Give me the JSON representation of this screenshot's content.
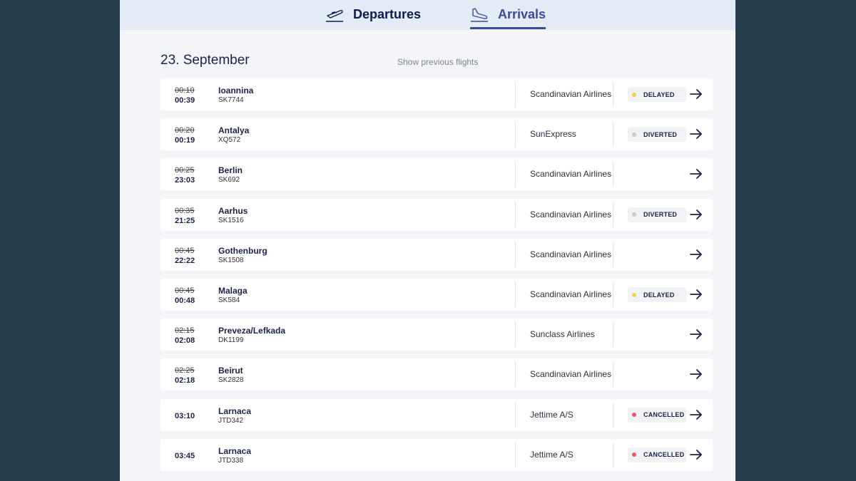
{
  "tabs": {
    "departures": "Departures",
    "arrivals": "Arrivals"
  },
  "date_title": "23. September",
  "show_previous": "Show previous flights",
  "colors": {
    "delayed_dot": "#f3d24a",
    "diverted_dot": "#c9ccd2",
    "cancelled_dot": "#f0546a"
  },
  "flights": [
    {
      "scheduled": "00:10",
      "actual": "00:39",
      "destination": "Ioannina",
      "flight_no": "SK7744",
      "airline": "Scandinavian Airlines",
      "status": "DELAYED"
    },
    {
      "scheduled": "00:20",
      "actual": "00:19",
      "destination": "Antalya",
      "flight_no": "XQ572",
      "airline": "SunExpress",
      "status": "DIVERTED"
    },
    {
      "scheduled": "00:25",
      "actual": "23:03",
      "destination": "Berlin",
      "flight_no": "SK692",
      "airline": "Scandinavian Airlines",
      "status": ""
    },
    {
      "scheduled": "00:35",
      "actual": "21:25",
      "destination": "Aarhus",
      "flight_no": "SK1516",
      "airline": "Scandinavian Airlines",
      "status": "DIVERTED"
    },
    {
      "scheduled": "00:45",
      "actual": "22:22",
      "destination": "Gothenburg",
      "flight_no": "SK1508",
      "airline": "Scandinavian Airlines",
      "status": ""
    },
    {
      "scheduled": "00:45",
      "actual": "00:48",
      "destination": "Malaga",
      "flight_no": "SK584",
      "airline": "Scandinavian Airlines",
      "status": "DELAYED"
    },
    {
      "scheduled": "02:15",
      "actual": "02:08",
      "destination": "Preveza/Lefkada",
      "flight_no": "DK1199",
      "airline": "Sunclass Airlines",
      "status": ""
    },
    {
      "scheduled": "02:25",
      "actual": "02:18",
      "destination": "Beirut",
      "flight_no": "SK2828",
      "airline": "Scandinavian Airlines",
      "status": ""
    },
    {
      "scheduled": "",
      "actual": "03:10",
      "destination": "Larnaca",
      "flight_no": "JTD342",
      "airline": "Jettime A/S",
      "status": "CANCELLED"
    },
    {
      "scheduled": "",
      "actual": "03:45",
      "destination": "Larnaca",
      "flight_no": "JTD338",
      "airline": "Jettime A/S",
      "status": "CANCELLED"
    }
  ]
}
